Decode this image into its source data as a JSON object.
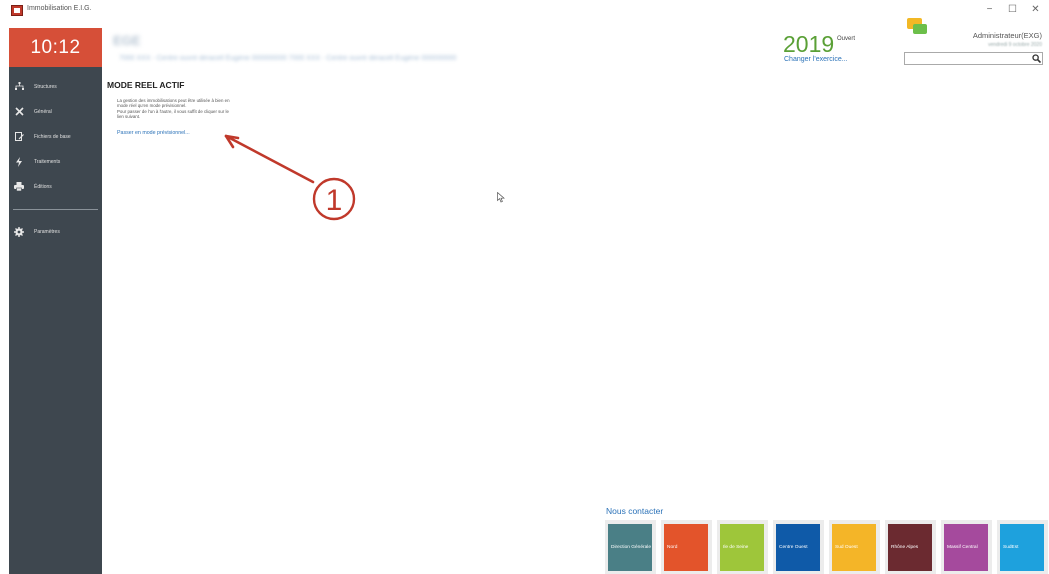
{
  "window": {
    "title": "Immobilisation E.I.G.",
    "controls": [
      "−",
      "☐",
      "✕"
    ]
  },
  "sidebar": {
    "clock": "10:12",
    "items": [
      {
        "label": "Structures",
        "icon": "hierarchy-icon"
      },
      {
        "label": "Général",
        "icon": "tools-icon"
      },
      {
        "label": "Fichiers de base",
        "icon": "document-edit-icon"
      },
      {
        "label": "Traitements",
        "icon": "bolt-icon"
      },
      {
        "label": "Éditions",
        "icon": "printer-icon"
      }
    ],
    "settings": {
      "label": "Paramètres",
      "icon": "gear-icon"
    }
  },
  "header": {
    "company_name": "EGE",
    "company_address": "7000 XXX - Centre ouvré déracell Eugène 000000000 7000 XXX - Centre ouvré déracell Eugène 000000000",
    "fiscal_year": "2019",
    "year_status": "Ouvert",
    "change_year_link": "Changer l'exercice...",
    "user_name": "Administrateur(EXG)",
    "user_date": "vendredi 9 octobre 2020",
    "search": {
      "value": "",
      "placeholder": ""
    }
  },
  "main": {
    "mode_title": "MODE REEL ACTIF",
    "description_lines": [
      "La gestion des immobilisations peut être utilisée à bien en",
      "mode réel qu'en mode prévisionnel.",
      "Pour passer de l'un à l'autre, il vous suffit de cliquer sur le",
      "lien suivant."
    ],
    "switch_mode_link": "Passer en mode prévisionnel..."
  },
  "annotation": {
    "label": "1",
    "color": "#c0392b"
  },
  "contact": {
    "title": "Nous contacter",
    "tiles": [
      {
        "label": "Direction Générale",
        "color": "#4a7f86"
      },
      {
        "label": "Nord",
        "color": "#e3542b"
      },
      {
        "label": "Ile de Seine",
        "color": "#9ec63a"
      },
      {
        "label": "Centre Ouest",
        "color": "#0f5aa8"
      },
      {
        "label": "Sud Ouest",
        "color": "#f4b528"
      },
      {
        "label": "Rhône Alpes",
        "color": "#6b2a30"
      },
      {
        "label": "Massif Central",
        "color": "#a54a9d"
      },
      {
        "label": "SudEst",
        "color": "#1ea1dd"
      }
    ]
  },
  "colors": {
    "sidebar_bg": "#3e474f",
    "clock_bg": "#d64f38",
    "year_green": "#5aa036",
    "link_blue": "#2b72b8"
  }
}
